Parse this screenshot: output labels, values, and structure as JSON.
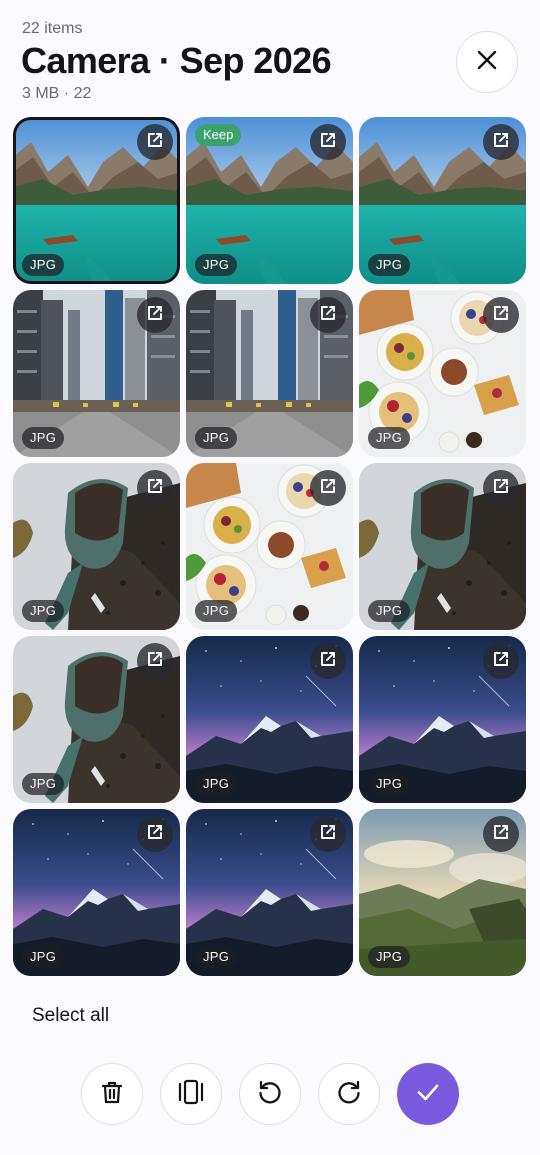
{
  "header": {
    "item_count": "22 items",
    "title": "Camera · Sep 2026",
    "subtitle": "3 MB · 22"
  },
  "icons": {
    "close": "close-icon",
    "open": "external-link-icon",
    "delete": "trash-icon",
    "compare": "compare-icon",
    "rotate_left": "rotate-left-icon",
    "rotate_right": "rotate-right-icon",
    "confirm": "check-icon"
  },
  "grid": {
    "tiles": [
      {
        "scene": "lake",
        "type": "JPG",
        "selected": true,
        "badge": ""
      },
      {
        "scene": "lake",
        "type": "JPG",
        "selected": false,
        "badge": "Keep"
      },
      {
        "scene": "lake",
        "type": "JPG",
        "selected": false,
        "badge": ""
      },
      {
        "scene": "city",
        "type": "JPG",
        "selected": false,
        "badge": ""
      },
      {
        "scene": "city",
        "type": "JPG",
        "selected": false,
        "badge": ""
      },
      {
        "scene": "food",
        "type": "JPG",
        "selected": false,
        "badge": ""
      },
      {
        "scene": "soil",
        "type": "JPG",
        "selected": false,
        "badge": ""
      },
      {
        "scene": "food",
        "type": "JPG",
        "selected": false,
        "badge": ""
      },
      {
        "scene": "soil",
        "type": "JPG",
        "selected": false,
        "badge": ""
      },
      {
        "scene": "soil",
        "type": "JPG",
        "selected": false,
        "badge": ""
      },
      {
        "scene": "night",
        "type": "JPG",
        "selected": false,
        "badge": ""
      },
      {
        "scene": "night",
        "type": "JPG",
        "selected": false,
        "badge": ""
      },
      {
        "scene": "night",
        "type": "JPG",
        "selected": false,
        "badge": ""
      },
      {
        "scene": "night",
        "type": "JPG",
        "selected": false,
        "badge": ""
      },
      {
        "scene": "valley",
        "type": "JPG",
        "selected": false,
        "badge": ""
      }
    ]
  },
  "footer": {
    "select_all_label": "Select all"
  },
  "colors": {
    "accent": "#7a5be0",
    "keep_badge": "#3aa36d",
    "selected_ring": "#16151a"
  }
}
